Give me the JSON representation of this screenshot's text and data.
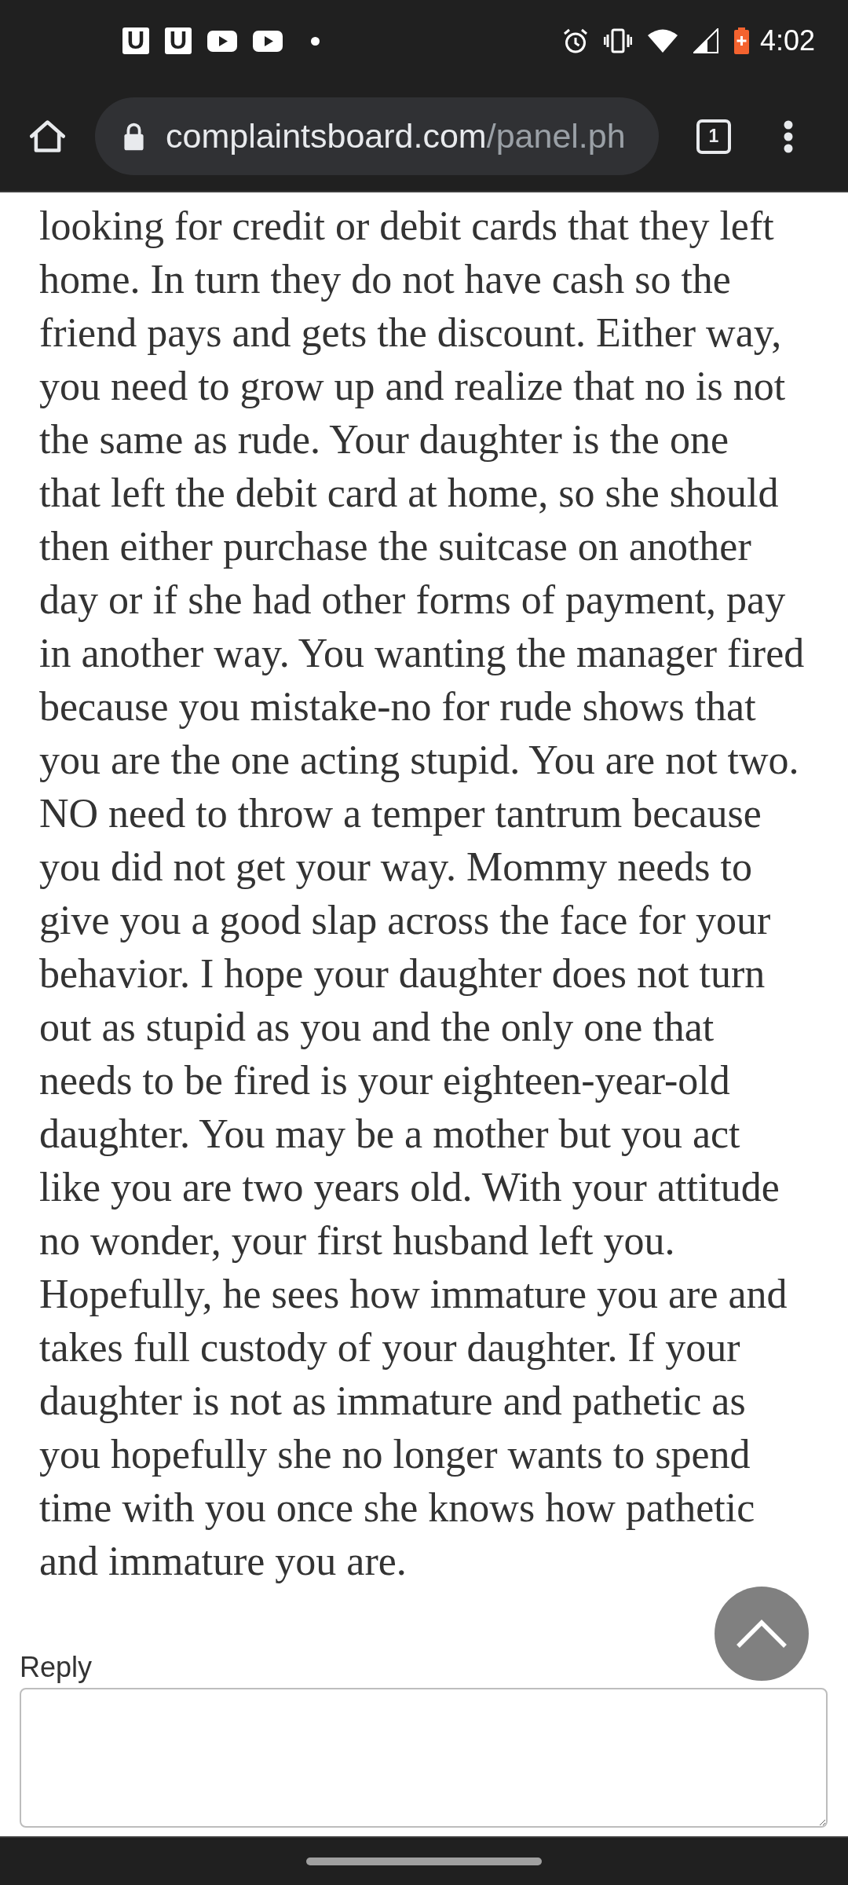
{
  "status_bar": {
    "notification_icons": [
      {
        "kind": "app",
        "letter": "U"
      },
      {
        "kind": "app",
        "letter": "U"
      },
      {
        "kind": "video"
      },
      {
        "kind": "video"
      },
      {
        "kind": "more"
      }
    ],
    "time": "4:02"
  },
  "browser_toolbar": {
    "url": {
      "host": "complaintsboard.com",
      "path": "/panel.ph"
    },
    "tab_count": "1"
  },
  "comment": {
    "lines": [
      "looking for credit or debit cards that they left",
      "home. In turn they do not have cash so the",
      "friend pays and gets the discount. Either way,",
      "you need to grow up and realize that no is not",
      "the same as rude. Your daughter is the one",
      "that left the debit card at home, so she should",
      "then either purchase the suitcase on another",
      "day or if she had other forms of payment, pay",
      "in another way. You wanting the manager fired",
      "because you mistake-no for rude shows that",
      "you are the one acting stupid. You are not two.",
      "NO need to throw a temper tantrum because",
      "you did not get your way. Mommy needs to",
      "give you a good slap across the face for your",
      "behavior. I hope your daughter does not turn",
      "out as stupid as you and the only one that",
      "needs to be fired is your eighteen-year-old",
      "daughter. You may be a mother but you act",
      "like you are two years old. With your attitude",
      "no wonder, your first husband left you.",
      "Hopefully, he sees how immature you are and",
      "takes full custody of your daughter. If your",
      "daughter is not as immature and pathetic as",
      "you hopefully she no longer wants to spend",
      "time with you once she knows how pathetic",
      "and immature you are."
    ]
  },
  "reply": {
    "label": "Reply"
  }
}
